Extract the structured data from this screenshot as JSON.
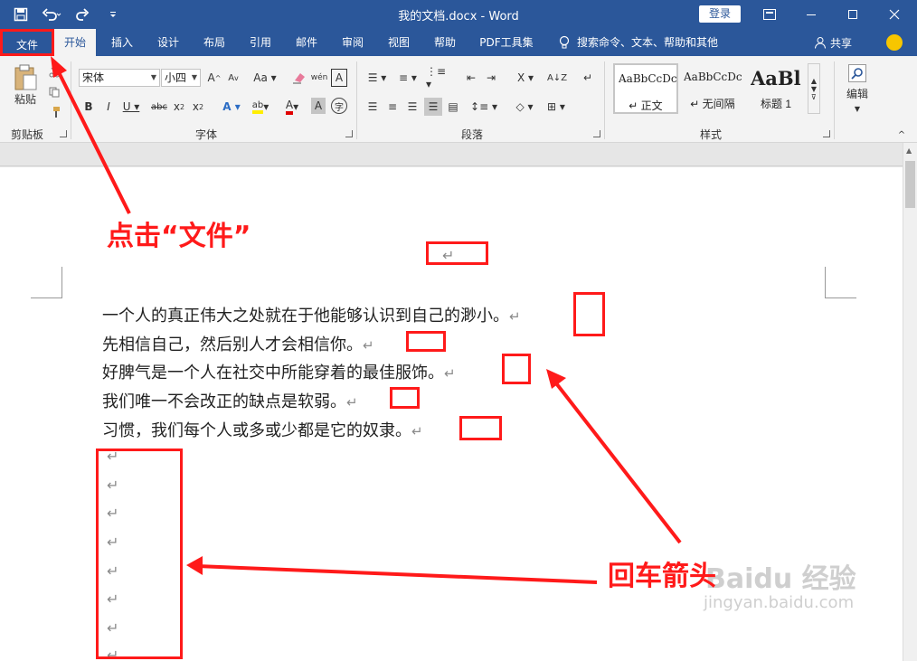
{
  "window": {
    "title": "我的文档.docx - Word",
    "login": "登录"
  },
  "qat": {
    "save_icon": "save-icon",
    "undo_icon": "undo-icon",
    "redo_icon": "redo-icon",
    "customize_icon": "customize-qat-icon"
  },
  "tabs": [
    "文件",
    "开始",
    "插入",
    "设计",
    "布局",
    "引用",
    "邮件",
    "审阅",
    "视图",
    "帮助",
    "PDF工具集"
  ],
  "active_tab": "开始",
  "tell_me": "搜索命令、文本、帮助和其他",
  "share": "共享",
  "ribbon": {
    "clipboard": {
      "paste": "粘贴",
      "label": "剪贴板"
    },
    "font": {
      "name": "宋体",
      "size": "小四",
      "label": "字体"
    },
    "paragraph": {
      "label": "段落"
    },
    "styles": {
      "label": "样式",
      "items": [
        {
          "sample": "AaBbCcDc",
          "name": "↵ 正文"
        },
        {
          "sample": "AaBbCcDc",
          "name": "↵ 无间隔"
        },
        {
          "sample": "AaBl",
          "name": "标题 1"
        }
      ]
    },
    "editing": {
      "label": "编辑"
    }
  },
  "document": {
    "lines": [
      "一个人的真正伟大之处就在于他能够认识到自己的渺小。",
      "先相信自己，然后别人才会相信你。",
      "好脾气是一个人在社交中所能穿着的最佳服饰。",
      "我们唯一不会改正的缺点是软弱。",
      "习惯，我们每个人或多或少都是它的奴隶。"
    ],
    "paragraph_mark": "↵"
  },
  "annotations": {
    "click_file": "点击“文件”",
    "return_arrow": "回车箭头",
    "color": "#ff1a1a"
  },
  "watermark": {
    "brand": "Baidu 经验",
    "url": "jingyan.baidu.com"
  },
  "colors": {
    "titlebar": "#2b579a",
    "ribbon": "#f3f3f3",
    "annotation": "#ff1a1a"
  }
}
